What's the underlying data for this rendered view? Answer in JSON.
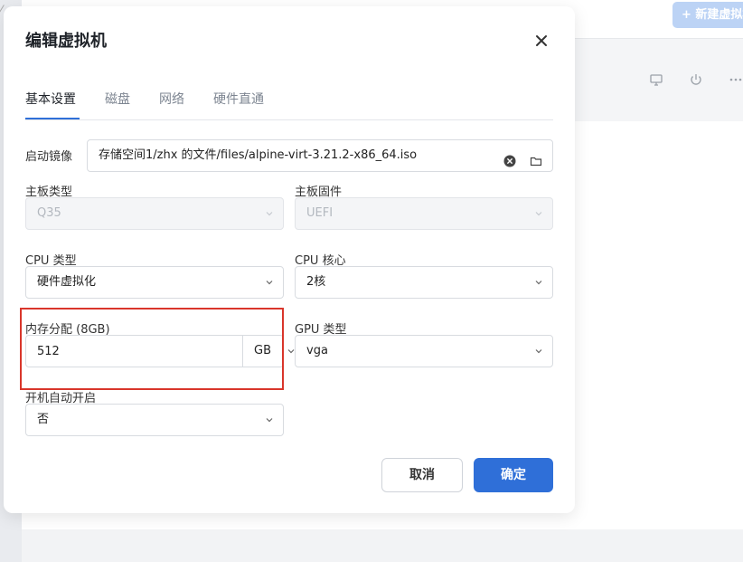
{
  "background": {
    "new_vm_button": "+ 新建虚拟机"
  },
  "dialog": {
    "title": "编辑虚拟机",
    "tabs": [
      {
        "label": "基本设置",
        "active": true
      },
      {
        "label": "磁盘",
        "active": false
      },
      {
        "label": "网络",
        "active": false
      },
      {
        "label": "硬件直通",
        "active": false
      }
    ],
    "boot_image": {
      "label": "启动镜像",
      "value": "存储空间1/zhx 的文件/files/alpine-virt-3.21.2-x86_64.iso"
    },
    "board_type": {
      "label": "主板类型",
      "value": "Q35",
      "disabled": true
    },
    "board_firmware": {
      "label": "主板固件",
      "value": "UEFI",
      "disabled": true
    },
    "cpu_type": {
      "label": "CPU 类型",
      "value": "硬件虚拟化"
    },
    "cpu_cores": {
      "label": "CPU 核心",
      "value": "2核"
    },
    "memory": {
      "label": "内存分配 (8GB)",
      "value": "512",
      "unit": "GB"
    },
    "gpu_type": {
      "label": "GPU 类型",
      "value": "vga"
    },
    "autostart": {
      "label": "开机自动开启",
      "value": "否"
    },
    "cancel_label": "取消",
    "ok_label": "确定"
  },
  "colors": {
    "accent": "#2f6fd8",
    "highlight": "#d9362b"
  }
}
